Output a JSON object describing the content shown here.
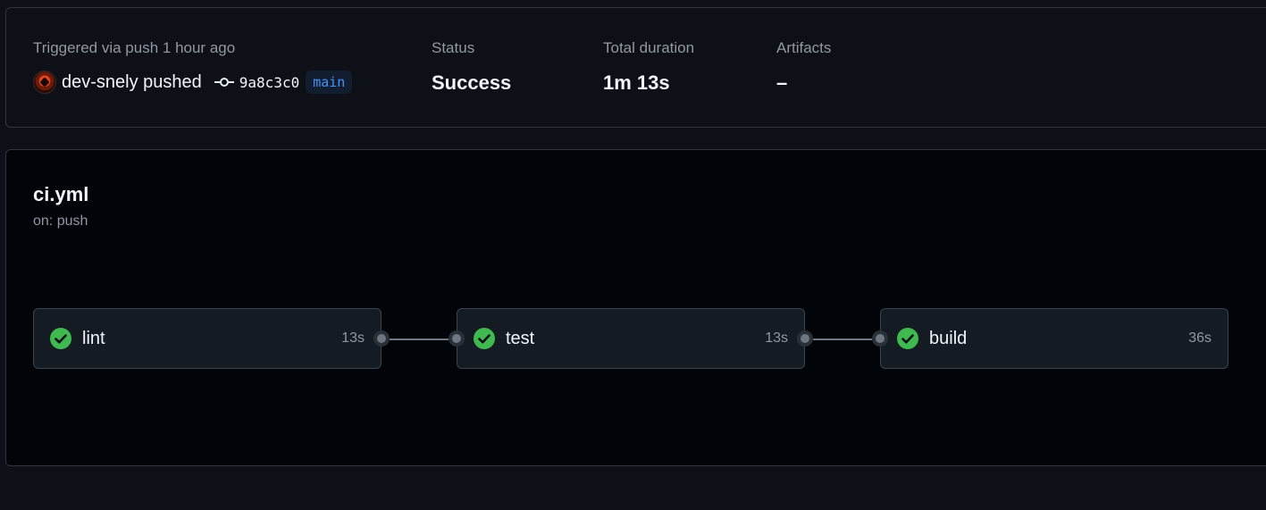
{
  "summary": {
    "trigger_label": "Triggered via push 1 hour ago",
    "actor": "dev-snely pushed",
    "commit_sha": "9a8c3c0",
    "branch": "main",
    "status_label": "Status",
    "status_value": "Success",
    "duration_label": "Total duration",
    "duration_value": "1m 13s",
    "artifacts_label": "Artifacts",
    "artifacts_value": "–"
  },
  "workflow": {
    "file": "ci.yml",
    "trigger": "on: push",
    "jobs": [
      {
        "name": "lint",
        "duration": "13s",
        "status": "success"
      },
      {
        "name": "test",
        "duration": "13s",
        "status": "success"
      },
      {
        "name": "build",
        "duration": "36s",
        "status": "success"
      }
    ]
  },
  "colors": {
    "background": "#0d1117",
    "graph_background": "#010409",
    "success": "#3fb950",
    "branch": "#4493f8",
    "muted": "#9198a1",
    "border": "#30363d"
  },
  "icons": {
    "job_status": "check-circle-fill-icon",
    "commit": "git-commit-icon",
    "avatar": "user-avatar"
  }
}
